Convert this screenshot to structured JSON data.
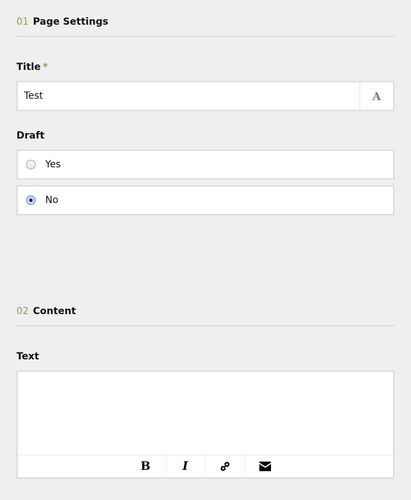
{
  "sections": [
    {
      "number": "01",
      "title": "Page Settings"
    },
    {
      "number": "02",
      "title": "Content"
    }
  ],
  "fields": {
    "title": {
      "label": "Title",
      "required_mark": "*",
      "value": "Test",
      "addon": "A"
    },
    "draft": {
      "label": "Draft",
      "options": [
        {
          "label": "Yes",
          "checked": false
        },
        {
          "label": "No",
          "checked": true
        }
      ]
    },
    "text": {
      "label": "Text",
      "value": "",
      "toolbar": [
        "bold",
        "italic",
        "link",
        "email"
      ],
      "bold_glyph": "B",
      "italic_glyph": "I"
    }
  }
}
